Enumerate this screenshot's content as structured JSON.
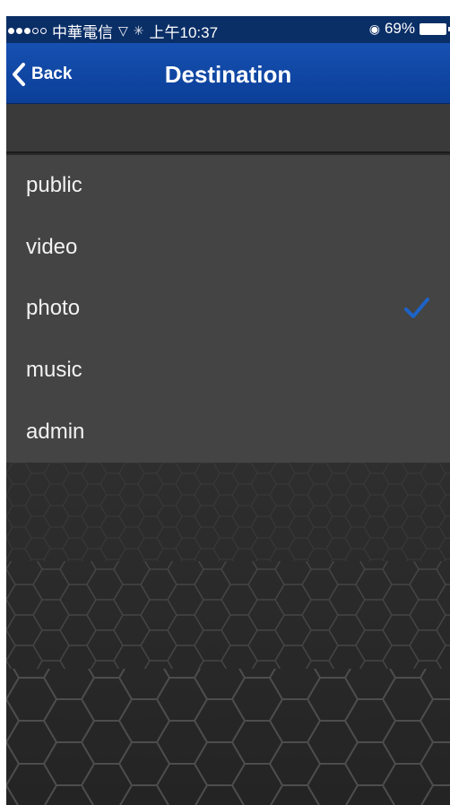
{
  "status_bar": {
    "carrier": "中華電信",
    "time": "上午10:37",
    "battery": "69%"
  },
  "nav": {
    "back_label": "Back",
    "title": "Destination"
  },
  "destinations": [
    {
      "label": "public",
      "selected": false
    },
    {
      "label": "video",
      "selected": false
    },
    {
      "label": "photo",
      "selected": true
    },
    {
      "label": "music",
      "selected": false
    },
    {
      "label": "admin",
      "selected": false
    }
  ],
  "colors": {
    "nav_bar": "#0b3f97",
    "check_accent": "#1e63c8",
    "list_bg": "#444444"
  }
}
